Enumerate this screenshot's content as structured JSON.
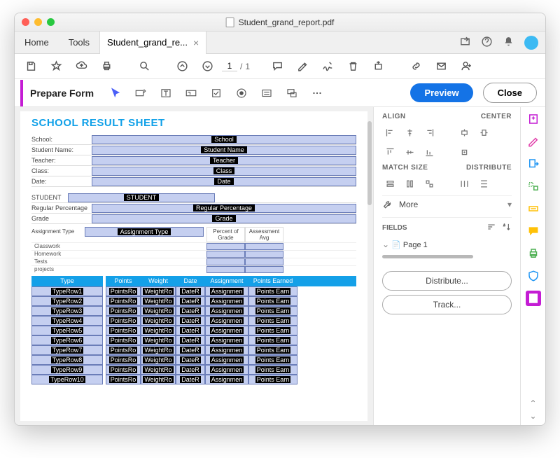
{
  "titlebar": {
    "filename": "Student_grand_report.pdf"
  },
  "tabs": {
    "home": "Home",
    "tools": "Tools",
    "doc": "Student_grand_re..."
  },
  "toolbar": {
    "page_current": "1",
    "page_total": "1"
  },
  "prepare": {
    "label": "Prepare Form",
    "preview": "Preview",
    "close": "Close"
  },
  "doc": {
    "title": "SCHOOL RESULT SHEET",
    "info_labels": [
      "School:",
      "Student Name:",
      "Teacher:",
      "Class:",
      "Date:"
    ],
    "info_fields": [
      "School",
      "Student Name",
      "Teacher",
      "Class",
      "Date"
    ],
    "student_label": "STUDENT",
    "student_field": "STUDENT",
    "reg_pct_label": "Regular Percentage",
    "reg_pct_field": "Regular Percentage",
    "grade_label": "Grade",
    "grade_field": "Grade",
    "assign_type_label": "Assignment Type",
    "assign_type_field": "Assignment Type",
    "pct_grade_label": "Percent of Grade",
    "assess_avg_label": "Assessment Avg",
    "mini_rows": [
      "Classwork",
      "Homework",
      "Tests",
      "projects"
    ],
    "grid_headers": {
      "type": "Type",
      "points": "Points",
      "weight": "Weight",
      "date": "Date",
      "assignment": "Assignment",
      "points_earned": "Points Earned"
    },
    "grid_rows": [
      {
        "type": "TypeRow1",
        "points": "PointsRo",
        "weight": "WeightRo",
        "date": "DateR",
        "assignment": "Assignmen",
        "points_earned": "Points Earn"
      },
      {
        "type": "TypeRow2",
        "points": "PointsRo",
        "weight": "WeightRo",
        "date": "DateR",
        "assignment": "Assignmen",
        "points_earned": "Points Earn"
      },
      {
        "type": "TypeRow3",
        "points": "PointsRo",
        "weight": "WeightRo",
        "date": "DateR",
        "assignment": "Assignmen",
        "points_earned": "Points Earn"
      },
      {
        "type": "TypeRow4",
        "points": "PointsRo",
        "weight": "WeightRo",
        "date": "DateR",
        "assignment": "Assignmen",
        "points_earned": "Points Earn"
      },
      {
        "type": "TypeRow5",
        "points": "PointsRo",
        "weight": "WeightRo",
        "date": "DateR",
        "assignment": "Assignmen",
        "points_earned": "Points Earn"
      },
      {
        "type": "TypeRow6",
        "points": "PointsRo",
        "weight": "WeightRo",
        "date": "DateR",
        "assignment": "Assignmen",
        "points_earned": "Points Earn"
      },
      {
        "type": "TypeRow7",
        "points": "PointsRo",
        "weight": "WeightRo",
        "date": "DateR",
        "assignment": "Assignmen",
        "points_earned": "Points Earn"
      },
      {
        "type": "TypeRow8",
        "points": "PointsRo",
        "weight": "WeightRo",
        "date": "DateR",
        "assignment": "Assignmen",
        "points_earned": "Points Earn"
      },
      {
        "type": "TypeRow9",
        "points": "PointsRo",
        "weight": "WeightRo",
        "date": "DateR",
        "assignment": "Assignmen",
        "points_earned": "Points Earn"
      },
      {
        "type": "TypeRow10",
        "points": "PointsRo",
        "weight": "WeightRo",
        "date": "DateR",
        "assignment": "Assignmen",
        "points_earned": "Points Earn"
      }
    ]
  },
  "panel": {
    "align": "ALIGN",
    "center": "CENTER",
    "match_size": "MATCH SIZE",
    "distribute_h": "DISTRIBUTE",
    "more": "More",
    "fields": "FIELDS",
    "page_node": "Page 1",
    "distribute_btn": "Distribute...",
    "track_btn": "Track..."
  }
}
